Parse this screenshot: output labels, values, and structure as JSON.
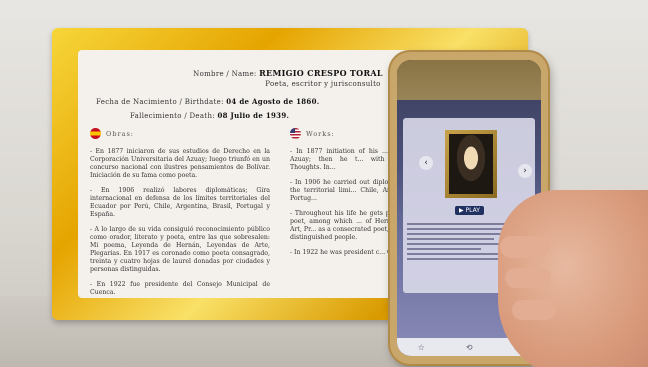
{
  "plaque": {
    "name_label": "Nombre / Name:",
    "name_value": "REMIGIO CRESPO TORAL",
    "role": "Poeta, escritor y jurisconsulto",
    "birth_label": "Fecha de Nacimiento / Birthdate:",
    "birth_value": "04 de Agosto de 1860.",
    "death_label": "Fallecimiento / Death:",
    "death_value": "08 Julio de 1939.",
    "es_heading": "Obras:",
    "en_heading": "Works:",
    "es_paragraphs": [
      "- En 1877 iniciaron de sus estudios de Derecho en la Corporación Universitaria del Azuay; luego triunfó en un concurso nacional con ilustres pensamientos de Bolívar. Iniciación de su fama como poeta.",
      "- En 1906 realizó labores diplomáticas; Gira internacional en defensa de los límites territoriales del Ecuador por Perú, Chile, Argentina, Brasil, Portugal y España.",
      "- A lo largo de su vida consiguió reconocimiento público como orador, literato y poeta, entre las que sobresalen: Mi poema, Leyenda de Hernán, Leyendas de Arte, Plegarias. En 1917 es coronado como poeta consagrado, treinta y cuatro hojas de laurel donadas por ciudades y personas distinguidas.",
      "- En 1922 fue presidente del Consejo Municipal de Cuenca."
    ],
    "en_paragraphs": [
      "- In 1877 initiation of his ... Corporation of Azuay; then he t... with Bolivar's Last Thoughts. In...",
      "- In 1906 he carried out diploma... defense of the territorial limi... Chile, Argentina, Brazil, Portug...",
      "- Throughout his life he gets pu... literary and poet, among which ... of Hernan, Legends of Art, Pr... as a consecrated poet, thirty-fou... and distinguished people.",
      "- In 1922 he was president c... Cuenca."
    ]
  },
  "phone": {
    "play_label": "▶ PLAY",
    "prev_icon": "‹",
    "next_icon": "›"
  },
  "colors": {
    "gold": "#e5a400",
    "plaque": "#f4f1ec"
  }
}
